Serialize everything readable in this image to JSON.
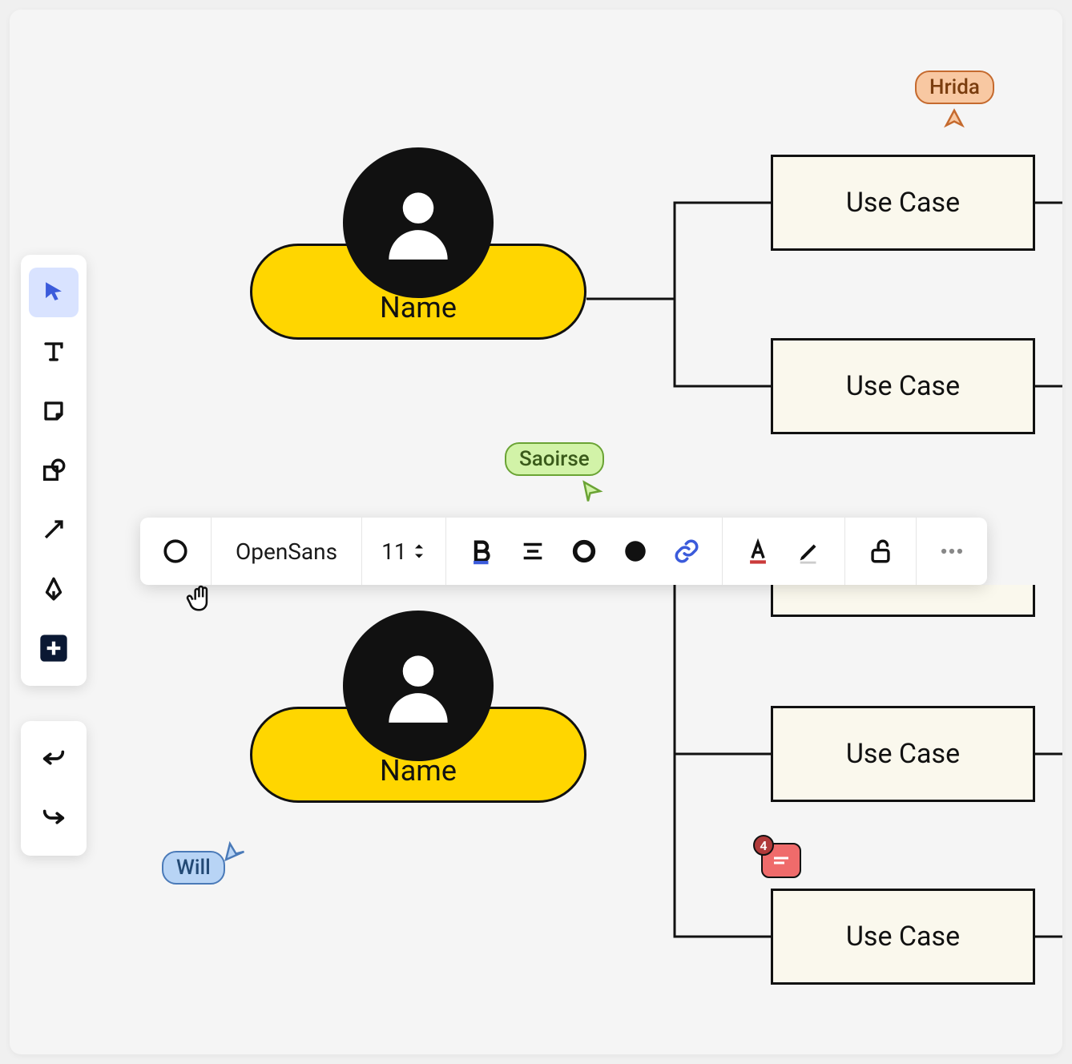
{
  "tools": {
    "select": "Select",
    "text": "Text",
    "note": "Sticky note",
    "shape": "Shape",
    "arrow": "Arrow",
    "pen": "Pen",
    "add": "Add"
  },
  "history": {
    "undo": "Undo",
    "redo": "Redo"
  },
  "contextual_toolbar": {
    "shape_style": "Ellipse outline",
    "font_family": "OpenSans",
    "font_size": "11",
    "bold": "Bold",
    "align": "Align center",
    "stroke": "Outline",
    "fill": "Fill",
    "link": "Link",
    "text_color": "Text color",
    "edit": "Edit",
    "lock": "Lock",
    "more": "More"
  },
  "diagram": {
    "actors": [
      {
        "id": "actor1",
        "label": "Name"
      },
      {
        "id": "actor2",
        "label": "Name"
      }
    ],
    "usecases": [
      {
        "id": "uc1",
        "label": "Use Case"
      },
      {
        "id": "uc2",
        "label": "Use Case"
      },
      {
        "id": "uc3",
        "label": "Use Case"
      },
      {
        "id": "uc4",
        "label": "Use Case"
      }
    ]
  },
  "collaborators": {
    "hrida": "Hrida",
    "saoirse": "Saoirse",
    "will": "Will"
  },
  "comment_count": "4"
}
